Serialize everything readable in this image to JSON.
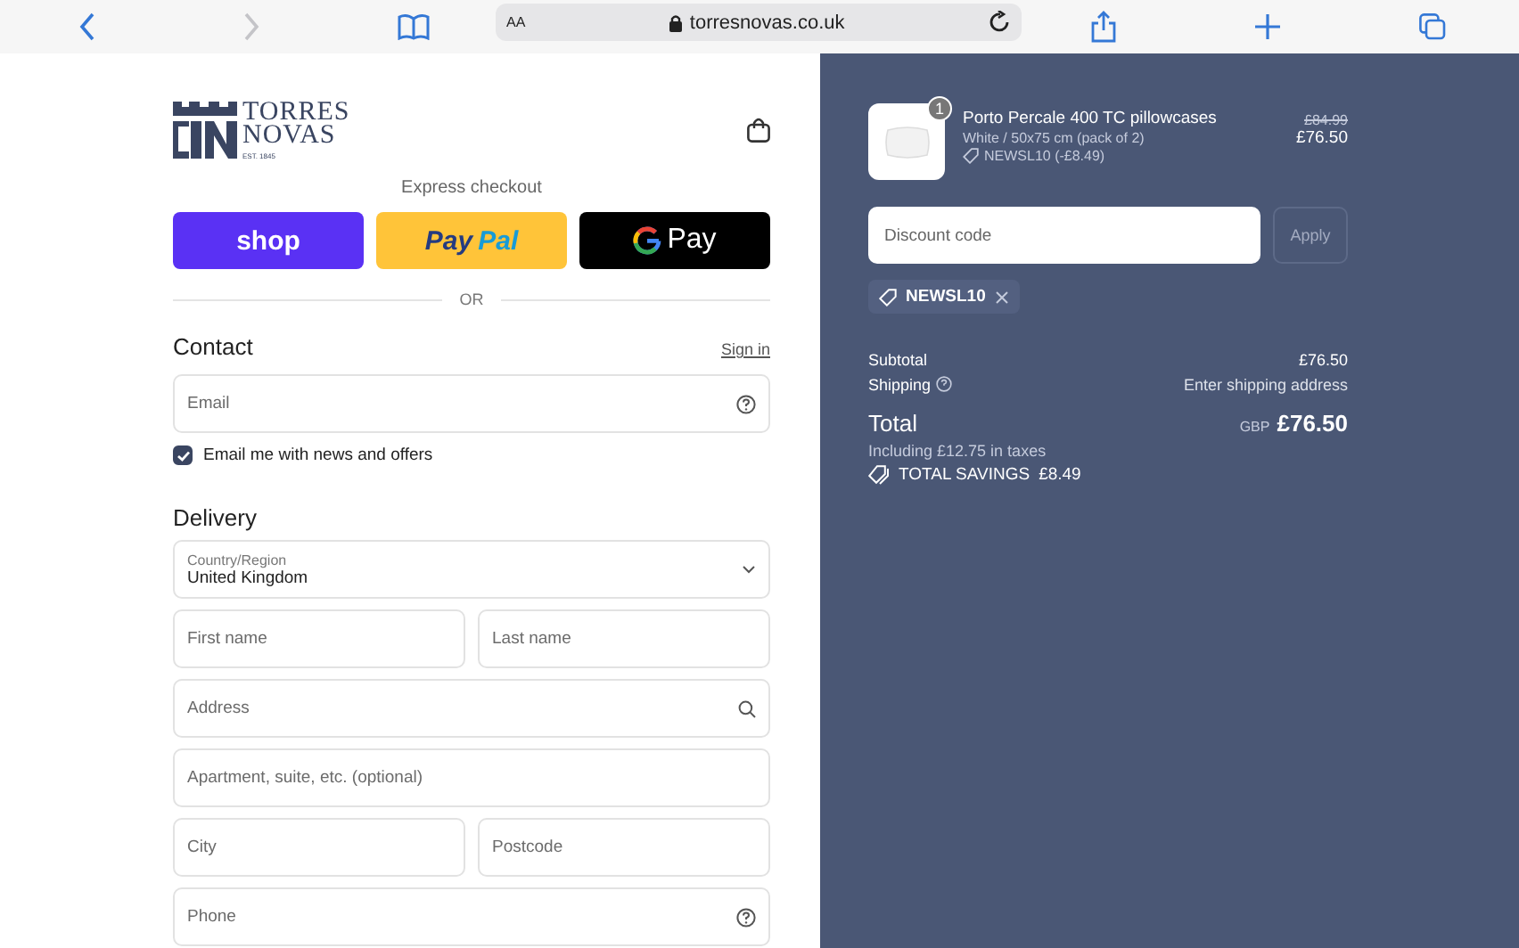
{
  "browser": {
    "text_size": "AA",
    "url": "torresnovas.co.uk"
  },
  "logo": {
    "line1": "TORRES",
    "line2": "NOVAS",
    "est": "EST. 1845"
  },
  "express": {
    "label": "Express checkout",
    "divider": "OR",
    "buttons": [
      {
        "kind": "shop",
        "parts": [
          "shop"
        ]
      },
      {
        "kind": "paypal",
        "parts": [
          "Pay",
          "Pal"
        ]
      },
      {
        "kind": "gpay",
        "parts": [
          "Pay"
        ]
      }
    ]
  },
  "contact": {
    "heading": "Contact",
    "sign_in": "Sign in",
    "email": {
      "placeholder": "Email",
      "kind": "help"
    },
    "newsletter": {
      "label": "Email me with news and offers",
      "checked": true
    }
  },
  "delivery": {
    "heading": "Delivery",
    "rows": [
      [
        {
          "kind": "select",
          "label": "Country/Region",
          "value": "United Kingdom"
        }
      ],
      [
        {
          "kind": "text",
          "placeholder": "First name"
        },
        {
          "kind": "text",
          "placeholder": "Last name"
        }
      ],
      [
        {
          "kind": "search",
          "placeholder": "Address"
        }
      ],
      [
        {
          "kind": "text",
          "placeholder": "Apartment, suite, etc. (optional)"
        }
      ],
      [
        {
          "kind": "text",
          "placeholder": "City"
        },
        {
          "kind": "text",
          "placeholder": "Postcode"
        }
      ],
      [
        {
          "kind": "help",
          "placeholder": "Phone"
        }
      ]
    ]
  },
  "summary": {
    "item": {
      "quantity": "1",
      "name": "Porto Percale 400 TC pillowcases",
      "variant": "White / 50x75 cm (pack of 2)",
      "discount": "NEWSL10 (-£8.49)",
      "original_price": "£84.99",
      "price": "£76.50"
    },
    "discount_field": {
      "placeholder": "Discount code",
      "button": "Apply",
      "disabled": true
    },
    "applied_code": "NEWSL10",
    "lines": [
      {
        "label": "Subtotal",
        "value": "£76.50",
        "help": false
      },
      {
        "label": "Shipping",
        "value": "Enter shipping address",
        "help": true
      }
    ],
    "total": {
      "label": "Total",
      "currency": "GBP",
      "amount": "£76.50",
      "taxes": "Including £12.75 in taxes",
      "savings_label": "TOTAL SAVINGS",
      "savings": "£8.49"
    }
  }
}
